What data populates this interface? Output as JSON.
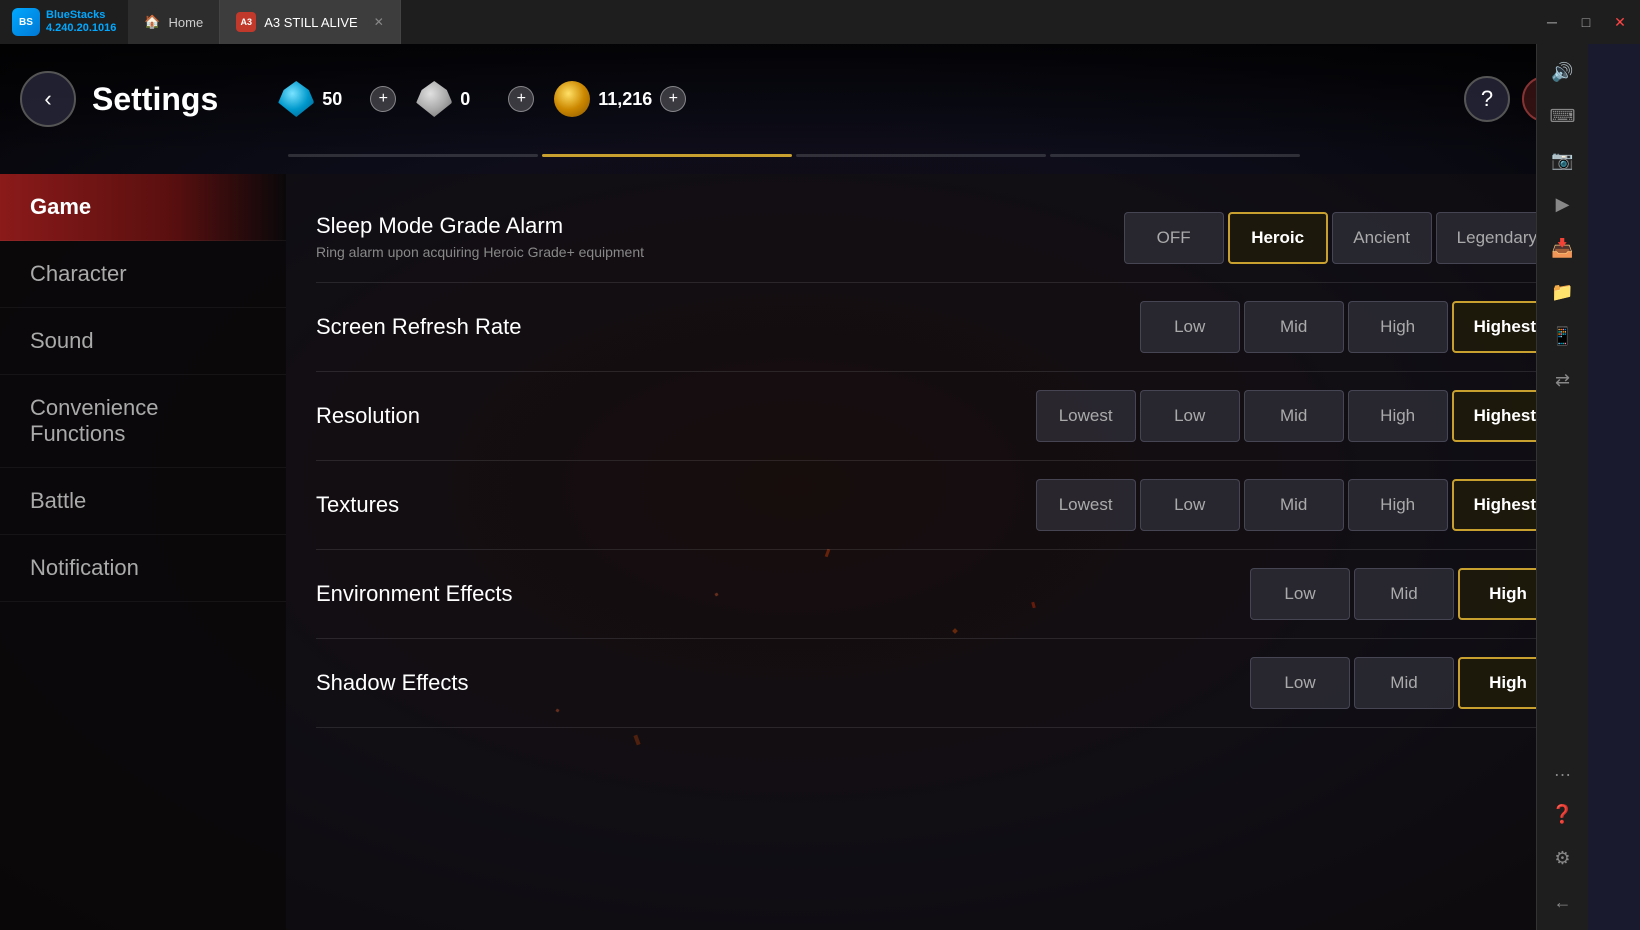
{
  "titlebar": {
    "logo_text_line1": "BlueStacks",
    "logo_text_line2": "4.240.20.1016",
    "tabs": [
      {
        "label": "Home",
        "active": false
      },
      {
        "label": "A3  STILL ALIVE",
        "active": true
      }
    ],
    "controls": [
      "─",
      "□",
      "✕"
    ]
  },
  "right_sidebar_buttons": [
    {
      "icon": "🔊",
      "name": "volume-icon"
    },
    {
      "icon": "⌨",
      "name": "keyboard-icon"
    },
    {
      "icon": "📷",
      "name": "screenshot-icon"
    },
    {
      "icon": "▶",
      "name": "play-icon"
    },
    {
      "icon": "📥",
      "name": "download-icon"
    },
    {
      "icon": "📁",
      "name": "folder-icon"
    },
    {
      "icon": "📱",
      "name": "device-icon"
    },
    {
      "icon": "⇄",
      "name": "sync-icon"
    },
    {
      "icon": "…",
      "name": "more-icon"
    },
    {
      "icon": "❓",
      "name": "help-icon"
    },
    {
      "icon": "⚙",
      "name": "settings-icon"
    },
    {
      "icon": "←",
      "name": "back-icon"
    }
  ],
  "game_header": {
    "back_label": "‹",
    "title": "Settings",
    "currencies": [
      {
        "name": "blue-diamond",
        "amount": "50",
        "color_class": "diamond-icon"
      },
      {
        "name": "silver-diamond",
        "amount": "0",
        "color_class": "silver-icon"
      },
      {
        "name": "gold-coin",
        "amount": "11,216",
        "color_class": "gold-icon"
      }
    ],
    "help_label": "?",
    "close_label": "✕"
  },
  "sidebar": {
    "items": [
      {
        "label": "Game",
        "active": true
      },
      {
        "label": "Character",
        "active": false
      },
      {
        "label": "Sound",
        "active": false
      },
      {
        "label": "Convenience Functions",
        "active": false
      },
      {
        "label": "Battle",
        "active": false
      },
      {
        "label": "Notification",
        "active": false
      }
    ]
  },
  "settings": [
    {
      "id": "sleep-mode-grade-alarm",
      "label": "Sleep Mode Grade Alarm",
      "description": "Ring alarm upon acquiring Heroic Grade+ equipment",
      "options": [
        {
          "label": "OFF",
          "selected": false
        },
        {
          "label": "Heroic",
          "selected": true
        },
        {
          "label": "Ancient",
          "selected": false
        },
        {
          "label": "Legendary",
          "selected": false
        }
      ]
    },
    {
      "id": "screen-refresh-rate",
      "label": "Screen Refresh Rate",
      "description": "",
      "options": [
        {
          "label": "Low",
          "selected": false
        },
        {
          "label": "Mid",
          "selected": false
        },
        {
          "label": "High",
          "selected": false
        },
        {
          "label": "Highest",
          "selected": true
        }
      ]
    },
    {
      "id": "resolution",
      "label": "Resolution",
      "description": "",
      "options": [
        {
          "label": "Lowest",
          "selected": false
        },
        {
          "label": "Low",
          "selected": false
        },
        {
          "label": "Mid",
          "selected": false
        },
        {
          "label": "High",
          "selected": false
        },
        {
          "label": "Highest",
          "selected": true
        }
      ]
    },
    {
      "id": "textures",
      "label": "Textures",
      "description": "",
      "options": [
        {
          "label": "Lowest",
          "selected": false
        },
        {
          "label": "Low",
          "selected": false
        },
        {
          "label": "Mid",
          "selected": false
        },
        {
          "label": "High",
          "selected": false
        },
        {
          "label": "Highest",
          "selected": true
        }
      ]
    },
    {
      "id": "environment-effects",
      "label": "Environment Effects",
      "description": "",
      "options": [
        {
          "label": "Low",
          "selected": false
        },
        {
          "label": "Mid",
          "selected": false
        },
        {
          "label": "High",
          "selected": true
        }
      ]
    },
    {
      "id": "shadow-effects",
      "label": "Shadow Effects",
      "description": "",
      "options": [
        {
          "label": "Low",
          "selected": false
        },
        {
          "label": "Mid",
          "selected": false
        },
        {
          "label": "High",
          "selected": true
        }
      ]
    }
  ],
  "tab_nav": {
    "tabs": [
      {
        "active": false
      },
      {
        "active": true
      },
      {
        "active": false
      },
      {
        "active": false
      }
    ]
  }
}
